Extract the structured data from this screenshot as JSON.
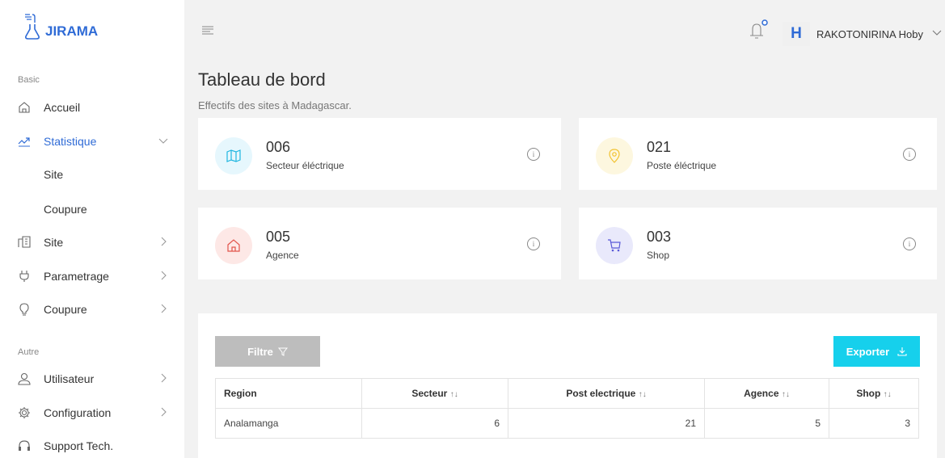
{
  "app": {
    "brand": "JIRAMA"
  },
  "sidebar": {
    "section_basic": "Basic",
    "section_autre": "Autre",
    "items": [
      {
        "label": "Accueil",
        "icon": "home-icon"
      },
      {
        "label": "Statistique",
        "icon": "trend-icon",
        "expanded": true,
        "children": [
          {
            "label": "Site"
          },
          {
            "label": "Coupure"
          }
        ]
      },
      {
        "label": "Site",
        "icon": "building-icon"
      },
      {
        "label": "Parametrage",
        "icon": "plug-icon"
      },
      {
        "label": "Coupure",
        "icon": "bulb-icon"
      },
      {
        "label": "Utilisateur",
        "icon": "user-icon"
      },
      {
        "label": "Configuration",
        "icon": "gear-icon"
      },
      {
        "label": "Support Tech.",
        "icon": "headset-icon"
      }
    ]
  },
  "header": {
    "avatar_initial": "H",
    "username": "RAKOTONIRINA Hoby"
  },
  "page": {
    "title": "Tableau de bord",
    "subtitle": "Effectifs des sites à Madagascar."
  },
  "cards": [
    {
      "value": "006",
      "label": "Secteur éléctrique",
      "icon": "map-icon",
      "bg": "#e6f7fd",
      "color": "#1fb6e0"
    },
    {
      "value": "021",
      "label": "Poste éléctrique",
      "icon": "location-pin-icon",
      "bg": "#fdf7df",
      "color": "#f2c230"
    },
    {
      "value": "005",
      "label": "Agence",
      "icon": "home-icon",
      "bg": "#fde8e6",
      "color": "#e2544b"
    },
    {
      "value": "003",
      "label": "Shop",
      "icon": "cart-icon",
      "bg": "#e9e9fb",
      "color": "#5a5ad8"
    }
  ],
  "toolbar": {
    "filter_label": "Filtre",
    "export_label": "Exporter"
  },
  "table": {
    "headers": [
      "Region",
      "Secteur",
      "Post electrique",
      "Agence",
      "Shop"
    ],
    "sort_glyph": "↑↓",
    "rows": [
      [
        "Analamanga",
        "6",
        "21",
        "5",
        "3"
      ]
    ]
  }
}
